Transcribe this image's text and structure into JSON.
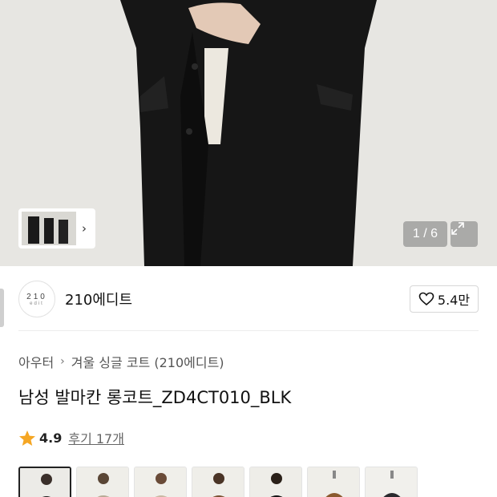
{
  "gallery": {
    "counter": "1 / 6",
    "thumb_next_icon": "chevron-right-icon",
    "expand_icon": "expand-icon"
  },
  "brand": {
    "logo_line1": "210",
    "logo_line2": "edit",
    "name": "210에디트"
  },
  "like": {
    "icon": "heart-outline-icon",
    "count": "5.4만"
  },
  "breadcrumb": {
    "items": [
      "아우터",
      "겨울 싱글 코트 (210에디트)"
    ],
    "separator_icon": "chevron-right-icon"
  },
  "product": {
    "title": "남성 발마칸 롱코트_ZD4CT010_BLK"
  },
  "rating": {
    "icon": "star-icon",
    "star_color": "#f5a623",
    "score": "4.9",
    "reviews": "후기 17개"
  },
  "variants": {
    "count": 7,
    "selected_index": 0,
    "colors": [
      "#1c1c1c",
      "#b8aa95",
      "#c9b8a2",
      "#7a5232",
      "#141414",
      "#8a5a2e",
      "#2a2a2e"
    ]
  }
}
